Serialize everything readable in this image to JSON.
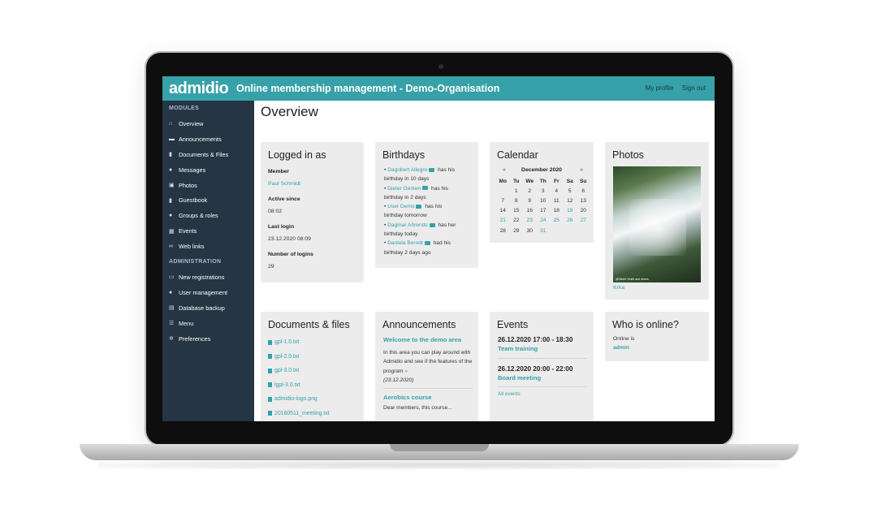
{
  "header": {
    "logo": "admidio",
    "title": "Online membership management - Demo-Organisation",
    "my_profile": "My profile",
    "sign_out": "Sign out"
  },
  "sidebar": {
    "modules_header": "MODULES",
    "modules": [
      {
        "label": "Overview",
        "icon": "home-icon"
      },
      {
        "label": "Announcements",
        "icon": "newspaper-icon"
      },
      {
        "label": "Documents & Files",
        "icon": "file-icon"
      },
      {
        "label": "Messages",
        "icon": "comments-icon"
      },
      {
        "label": "Photos",
        "icon": "image-icon"
      },
      {
        "label": "Guestbook",
        "icon": "book-icon"
      },
      {
        "label": "Groups & roles",
        "icon": "users-icon"
      },
      {
        "label": "Events",
        "icon": "calendar-icon"
      },
      {
        "label": "Web links",
        "icon": "link-icon"
      }
    ],
    "admin_header": "ADMINISTRATION",
    "admin": [
      {
        "label": "New registrations",
        "icon": "id-card-icon"
      },
      {
        "label": "User management",
        "icon": "user-group-icon"
      },
      {
        "label": "Database backup",
        "icon": "database-icon"
      },
      {
        "label": "Menu",
        "icon": "menu-icon"
      },
      {
        "label": "Preferences",
        "icon": "gear-icon"
      }
    ]
  },
  "main": {
    "title": "Overview",
    "logged_in": {
      "title": "Logged in as",
      "member_label": "Member",
      "member_value": "Paul Schmidt",
      "active_label": "Active since",
      "active_value": "08:02",
      "last_login_label": "Last login",
      "last_login_value": "23.12.2020 08:09",
      "logins_label": "Number of logins",
      "logins_value": "29"
    },
    "birthdays": {
      "title": "Birthdays",
      "items": [
        {
          "name": "Dagobert Allegre",
          "pre": "has his",
          "post": "birthday in 10 days"
        },
        {
          "name": "Dieter Gerken",
          "pre": "has his",
          "post": "birthday in 2 days"
        },
        {
          "name": "User Demo",
          "pre": "has his",
          "post": "birthday tomorrow"
        },
        {
          "name": "Dagmar Ahrends",
          "pre": "has her",
          "post": "birthday today"
        },
        {
          "name": "Daniela Berodt",
          "pre": "had his",
          "post": "birthday 2 days ago"
        }
      ]
    },
    "calendar": {
      "title": "Calendar",
      "prev": "«",
      "next": "»",
      "month": "December 2020",
      "days": [
        "Mo",
        "Tu",
        "We",
        "Th",
        "Fr",
        "Sa",
        "Su"
      ],
      "weeks": [
        [
          "",
          "1",
          "2",
          "3",
          "4",
          "5",
          "6"
        ],
        [
          "7",
          "8",
          "9",
          "10",
          "11",
          "12",
          "13"
        ],
        [
          "14",
          "15",
          "16",
          "17",
          "18",
          "19",
          "20"
        ],
        [
          "21",
          "22",
          "23",
          "24",
          "25",
          "26",
          "27"
        ],
        [
          "28",
          "29",
          "30",
          "31",
          "",
          "",
          ""
        ]
      ],
      "highlighted": [
        "19",
        "21",
        "23",
        "24",
        "25",
        "26",
        "27",
        "31"
      ]
    },
    "photos": {
      "title": "Photos",
      "caption": "Krka",
      "watermark": "@Stevie Smith and others"
    },
    "documents": {
      "title": "Documents & files",
      "files": [
        "gpl-1.0.txt",
        "gpl-2.0.txt",
        "gpl-3.0.txt",
        "lgpl-3.0.txt",
        "admidio-logo.png",
        "20160511_meeting.txt"
      ]
    },
    "announcements": {
      "title": "Announcements",
      "item1_title": "Welcome to the demo area",
      "item1_text": "In this area you can play around with Admidio and see if the features of the program",
      "item1_more": "»",
      "item1_date": "(23.12.2020)",
      "item2_title": "Aerobics course",
      "item2_text": "Dear members, this course..."
    },
    "events": {
      "title": "Events",
      "items": [
        {
          "datetime": "26.12.2020  17:00 - 18:30",
          "name": "Team training"
        },
        {
          "datetime": "26.12.2020  20:00 - 22:00",
          "name": "Board meeting"
        }
      ],
      "all_events": "All events"
    },
    "online": {
      "title": "Who is online?",
      "label": "Online is",
      "user": "admin"
    }
  }
}
